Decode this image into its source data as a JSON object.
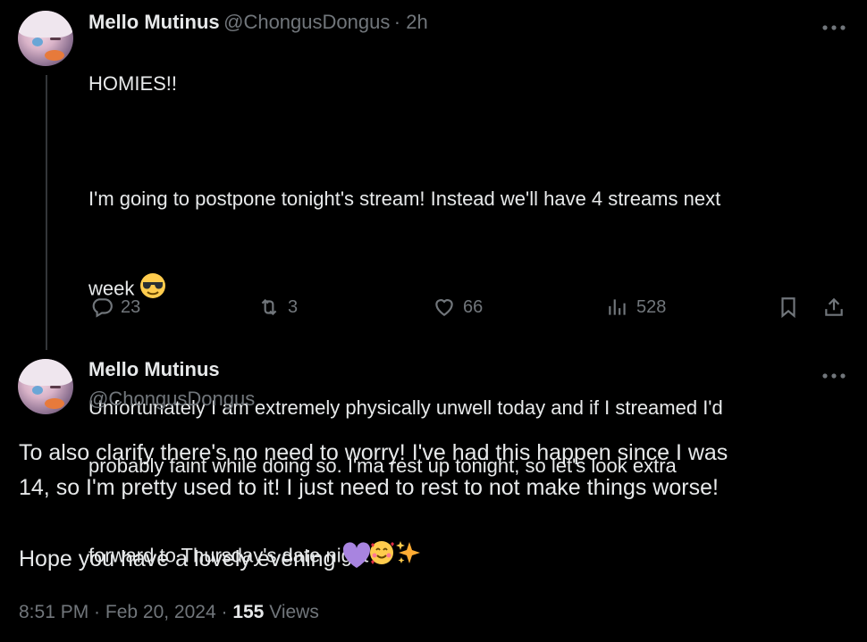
{
  "tweet1": {
    "name": "Mello Mutinus",
    "handle": "@ChongusDongus",
    "time": "· 2h",
    "line1": "HOMIES!!",
    "line2a": "I'm going to postpone tonight's stream! Instead we'll have 4 streams next",
    "line2b": "week",
    "line3a": "Unfortunately I am extremely physically unwell today and if I streamed I'd",
    "line3b": "probably faint while doing so. I'ma rest up tonight, so let's look extra",
    "line3c": "forward to Thursday's date night",
    "replies": "23",
    "retweets": "3",
    "likes": "66",
    "views": "528"
  },
  "tweet2": {
    "name": "Mello Mutinus",
    "handle": "@ChongusDongus",
    "para1a": "To also clarify there's no need to worry!  I've had this happen since I was",
    "para1b": "14, so I'm pretty used to it!  I just need to rest to not make things worse!",
    "para2": "Hope you have a lovely evening",
    "time": "8:51 PM · Feb 20, 2024 ·",
    "view_count": "155",
    "views_label": "Views"
  },
  "icons": {
    "reply": "reply-icon",
    "retweet": "retweet-icon",
    "like": "heart-icon",
    "views": "views-icon",
    "bookmark": "bookmark-icon",
    "share": "share-icon",
    "more": "more-icon"
  },
  "colors": {
    "background": "#000000",
    "text": "#e7e9ea",
    "muted": "#71767b",
    "purple_heart": "#a884e0"
  }
}
